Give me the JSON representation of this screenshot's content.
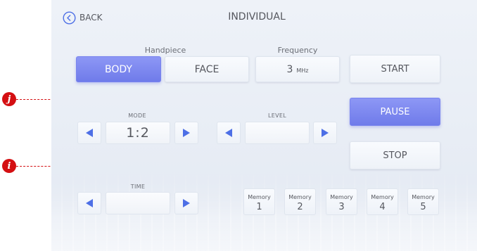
{
  "header": {
    "back_label": "BACK",
    "title": "INDIVIDUAL"
  },
  "handpiece": {
    "label": "Handpiece",
    "options": [
      {
        "label": "BODY",
        "selected": true
      },
      {
        "label": "FACE",
        "selected": false
      }
    ]
  },
  "frequency": {
    "label": "Frequency",
    "value": "3",
    "unit": "MHz"
  },
  "controls": {
    "start_label": "START",
    "pause_label": "PAUSE",
    "stop_label": "STOP"
  },
  "mode": {
    "label": "MODE",
    "value": "1:2"
  },
  "level": {
    "label": "LEVEL",
    "value": ""
  },
  "time": {
    "label": "TIME",
    "value": ""
  },
  "memory": [
    {
      "label": "Memory",
      "number": "1"
    },
    {
      "label": "Memory",
      "number": "2"
    },
    {
      "label": "Memory",
      "number": "3"
    },
    {
      "label": "Memory",
      "number": "4"
    },
    {
      "label": "Memory",
      "number": "5"
    }
  ],
  "markers": {
    "top": "j",
    "bottom": "i"
  },
  "colors": {
    "accent": "#7b86ef",
    "arrow": "#4d6fe6",
    "marker": "#d40f12"
  }
}
